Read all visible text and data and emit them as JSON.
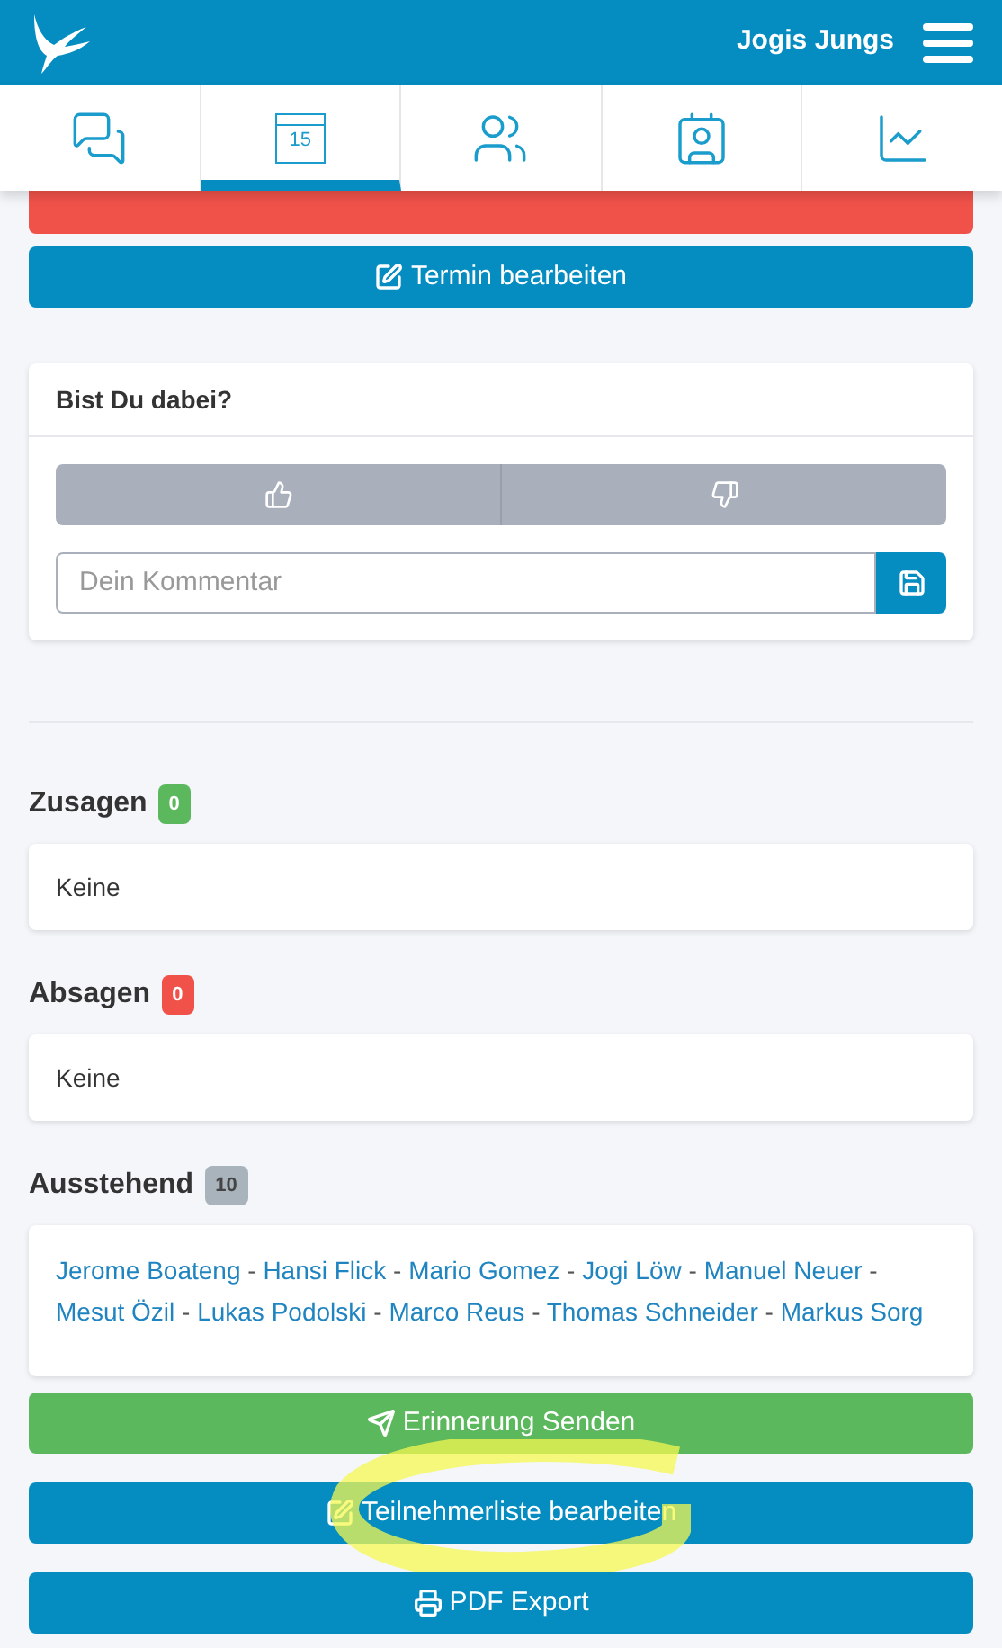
{
  "header": {
    "title": "Jogis Jungs"
  },
  "tabs": [
    {
      "kind": "chat",
      "selected": false
    },
    {
      "kind": "calendar",
      "day": "15",
      "selected": true
    },
    {
      "kind": "people",
      "selected": false
    },
    {
      "kind": "contact",
      "selected": false
    },
    {
      "kind": "chart",
      "selected": false
    }
  ],
  "actions_top": [
    {
      "kind": "delete"
    },
    {
      "kind": "edit",
      "label": "Termin bearbeiten"
    }
  ],
  "attendance": {
    "title": "Bist Du dabei?",
    "comment": {
      "placeholder": "Dein Kommentar"
    }
  },
  "groups": [
    {
      "title": "Zusagen",
      "count": "0",
      "color": "#5cb85c",
      "empty": "Keine"
    },
    {
      "title": "Absagen",
      "count": "0",
      "color": "#f0524a",
      "empty": "Keine"
    },
    {
      "title": "Ausstehend",
      "count": "10",
      "color": "#a9b3bb",
      "separator": "-",
      "members": [
        "Jerome Boateng",
        "Hansi Flick",
        "Mario Gomez",
        "Jogi Löw",
        "Manuel Neuer",
        "Mesut Özil",
        "Lukas Podolski",
        "Marco Reus",
        "Thomas Schneider",
        "Markus Sorg"
      ]
    }
  ],
  "actions_bottom": [
    {
      "kind": "send",
      "label": "Erinnerung Senden",
      "highlighted": false
    },
    {
      "kind": "edit",
      "label": "Teilnehmerliste bearbeiten",
      "highlighted": true
    },
    {
      "kind": "print",
      "label": "PDF Export",
      "highlighted": false
    }
  ]
}
